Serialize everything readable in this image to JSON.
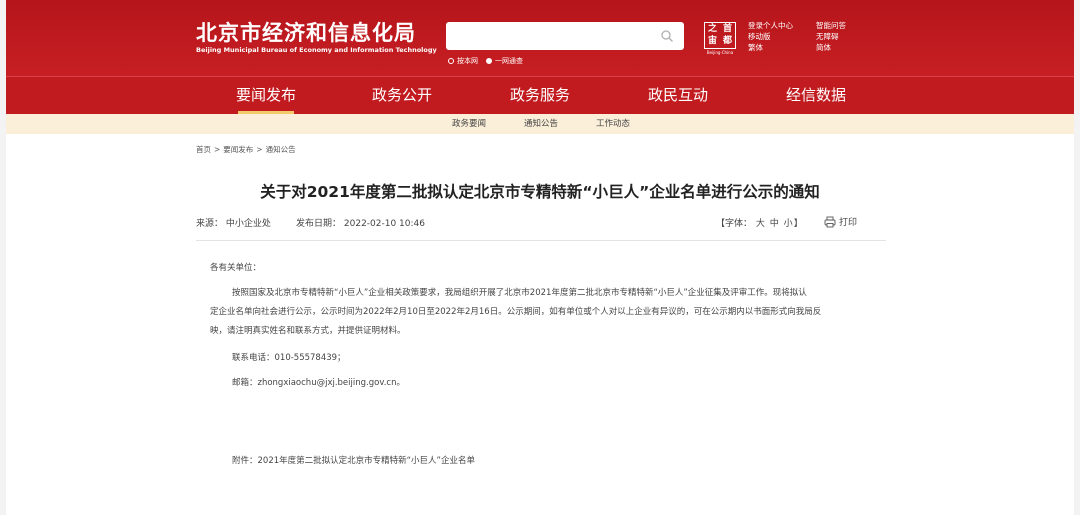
{
  "header": {
    "site_title": "北京市经济和信息化局",
    "site_subtitle": "Beijing Municipal Bureau of Economy and Information Technology",
    "search": {
      "placeholder": "",
      "scope_options": [
        "按本网",
        "一网通查"
      ],
      "selected_scope": "一网通查"
    },
    "logo": {
      "chars": [
        "之",
        "首",
        "宙",
        "都"
      ],
      "caption": "Beijing·China"
    },
    "top_links": [
      "登录个人中心",
      "智能问答",
      "移动版",
      "无障碍",
      "繁体",
      "简体"
    ]
  },
  "main_nav": {
    "items": [
      "要闻发布",
      "政务公开",
      "政务服务",
      "政民互动",
      "经信数据"
    ],
    "active": "要闻发布"
  },
  "sub_nav": {
    "items": [
      "政务要闻",
      "通知公告",
      "工作动态"
    ]
  },
  "breadcrumb": [
    "首页",
    "要闻发布",
    "通知公告"
  ],
  "breadcrumb_separator": ">",
  "article": {
    "title": "关于对2021年度第二批拟认定北京市专精特新“小巨人”企业名单进行公示的通知",
    "source_label": "来源：",
    "source": "中小企业处",
    "date_label": "发布日期：",
    "date": "2022-02-10 10:46",
    "font_size_label": "【字体：",
    "font_sizes": [
      "大",
      "中",
      "小"
    ],
    "font_size_close": "】",
    "print_label": "打印",
    "greeting": "各有关单位：",
    "body_lines": [
      "按照国家及北京市专精特新“小巨人”企业相关政策要求，我局组织开展了北京市2021年度第二批北京市专精特新“小巨人”企业征集及评审工作。现将拟认",
      "定企业名单向社会进行公示，公示时间为2022年2月10日至2022年2月16日。公示期间，如有单位或个人对以上企业有异议的，可在公示期内以书面形式向我局反",
      "映，请注明真实姓名和联系方式，并提供证明材料。"
    ],
    "phone": "联系电话：010-55578439；",
    "email": "邮箱：zhongxiaochu@jxj.beijing.gov.cn。",
    "attachment": "附件：2021年度第二批拟认定北京市专精特新“小巨人”企业名单"
  },
  "colors": {
    "header_red": "#c71f23",
    "nav_red": "#c11b20",
    "subnav_bg": "#fbefd9",
    "active_underline": "#f4c96a"
  }
}
